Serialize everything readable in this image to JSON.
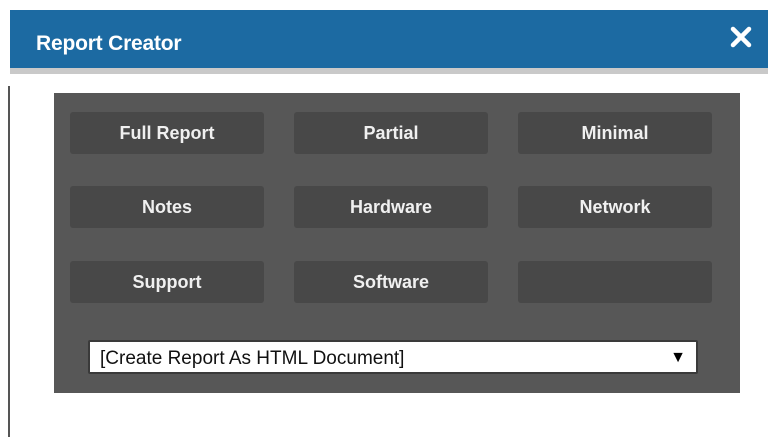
{
  "dialog": {
    "title": "Report Creator",
    "close_icon": "close-icon",
    "titlebar_color": "#1c6aa2",
    "panel_color": "#575757",
    "button_color": "#484848"
  },
  "buttons": [
    {
      "label": "Full Report"
    },
    {
      "label": "Partial"
    },
    {
      "label": "Minimal"
    },
    {
      "label": "Notes"
    },
    {
      "label": "Hardware"
    },
    {
      "label": "Network"
    },
    {
      "label": "Support"
    },
    {
      "label": "Software"
    },
    {
      "label": ""
    }
  ],
  "format_select": {
    "selected": "[Create Report As HTML Document]",
    "arrow_icon": "dropdown-arrow-icon"
  }
}
